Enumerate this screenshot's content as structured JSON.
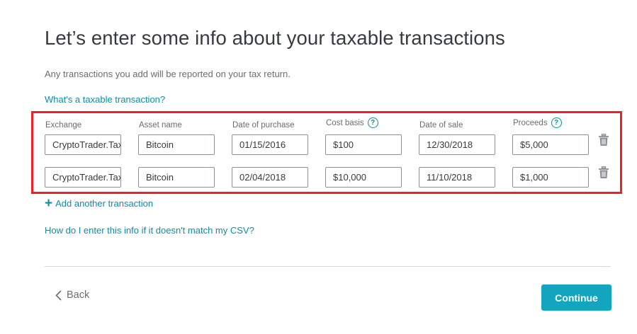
{
  "page": {
    "title": "Let’s enter some info about your taxable transactions",
    "subtitle": "Any transactions you add will be reported on your tax return.",
    "help_link": "What's a taxable transaction?"
  },
  "table": {
    "columns": [
      {
        "label": "Exchange",
        "help": false
      },
      {
        "label": "Asset name",
        "help": false
      },
      {
        "label": "Date of purchase",
        "help": false
      },
      {
        "label": "Cost basis",
        "help": true
      },
      {
        "label": "Date of sale",
        "help": false
      },
      {
        "label": "Proceeds",
        "help": true
      }
    ],
    "rows": [
      {
        "exchange": "CryptoTrader.Tax",
        "asset": "Bitcoin",
        "purchase_date": "01/15/2016",
        "cost_basis": "$100",
        "sale_date": "12/30/2018",
        "proceeds": "$5,000"
      },
      {
        "exchange": "CryptoTrader.Tax",
        "asset": "Bitcoin",
        "purchase_date": "02/04/2018",
        "cost_basis": "$10,000",
        "sale_date": "11/10/2018",
        "proceeds": "$1,000"
      }
    ],
    "help_glyph": "?",
    "delete_icon": "trash-icon"
  },
  "actions": {
    "add_transaction": "Add another transaction",
    "add_icon": "+",
    "csv_help": "How do I enter this info if it doesn't match my CSV?",
    "back": "Back",
    "continue": "Continue"
  },
  "colors": {
    "accent": "#0d8ea3",
    "primary_button": "#13a5c0",
    "highlight_border": "#ee2222",
    "text": "#393a3d",
    "muted_text": "#6b6c72"
  }
}
